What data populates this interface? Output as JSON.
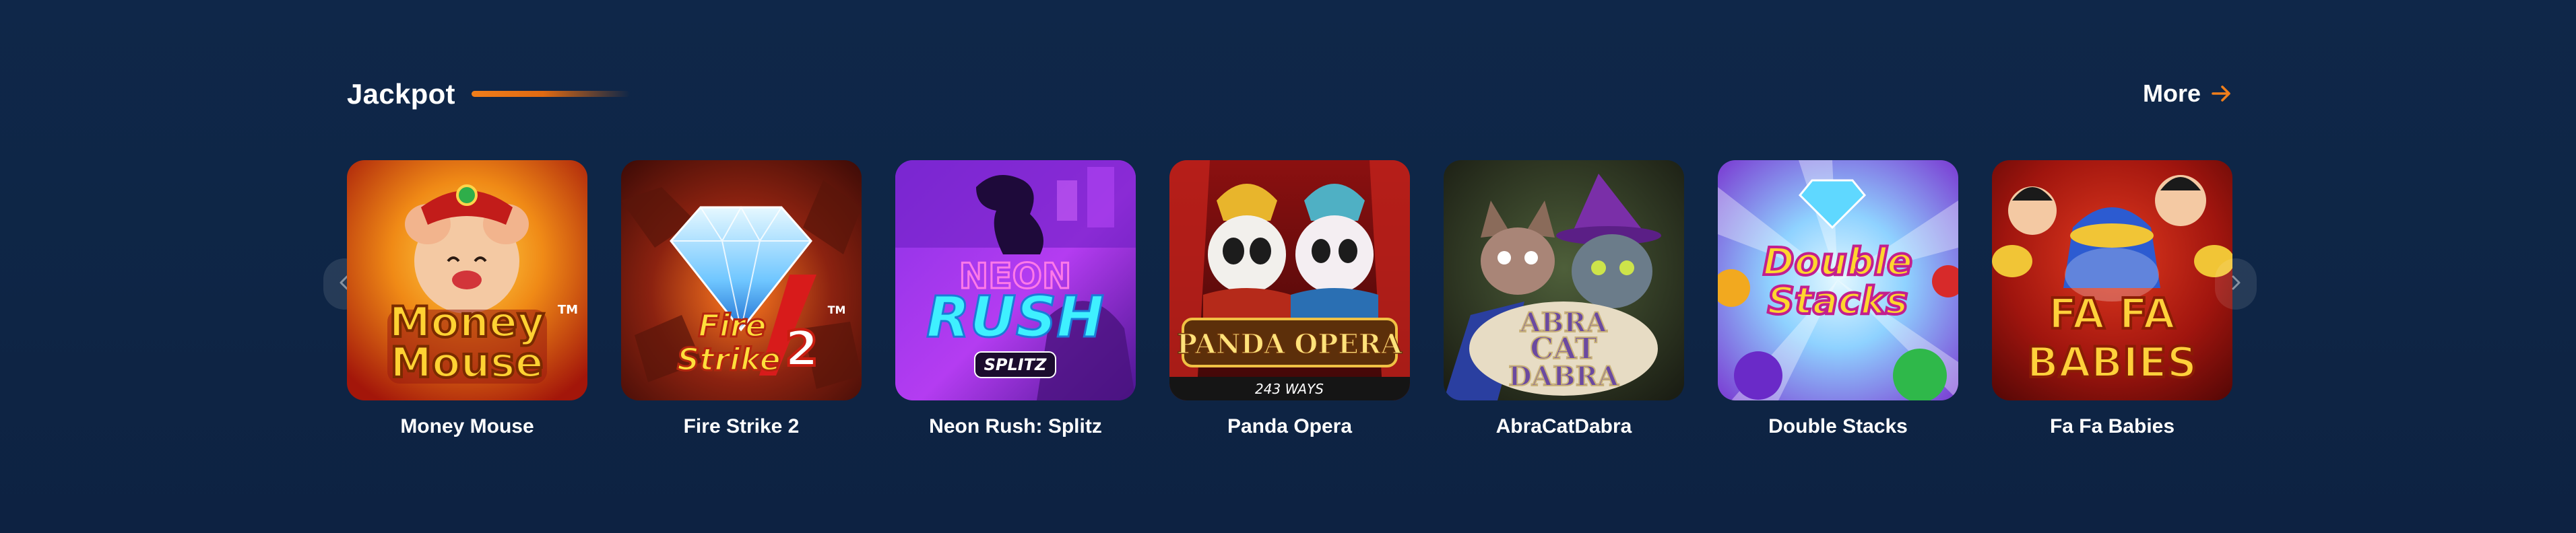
{
  "section": {
    "title": "Jackpot",
    "more_label": "More",
    "more_icon": "arrow-right-icon",
    "accent_color": "#f07e1b",
    "background_color": "#0f2547"
  },
  "carousel": {
    "prev_icon": "chevron-left-icon",
    "next_icon": "chevron-right-icon"
  },
  "games": [
    {
      "name": "Money Mouse",
      "logo_lines": [
        "Money",
        "Mouse"
      ],
      "logo_mark": "TM"
    },
    {
      "name": "Fire Strike 2",
      "logo_lines": [
        "Fire",
        "Strike"
      ],
      "logo_number": "2",
      "logo_mark": "TM"
    },
    {
      "name": "Neon Rush: Splitz",
      "logo_lines": [
        "NEON",
        "RUSH"
      ],
      "logo_badge": "SPLITZ"
    },
    {
      "name": "Panda Opera",
      "logo_lines": [
        "PANDA OPERA"
      ],
      "logo_subtitle": "243 WAYS"
    },
    {
      "name": "AbraCatDabra",
      "logo_lines": [
        "ABRA",
        "CAT",
        "DABRA"
      ]
    },
    {
      "name": "Double Stacks",
      "logo_lines": [
        "Double",
        "Stacks"
      ]
    },
    {
      "name": "Fa Fa Babies",
      "logo_lines": [
        "FA FA",
        "BABIES"
      ]
    }
  ]
}
